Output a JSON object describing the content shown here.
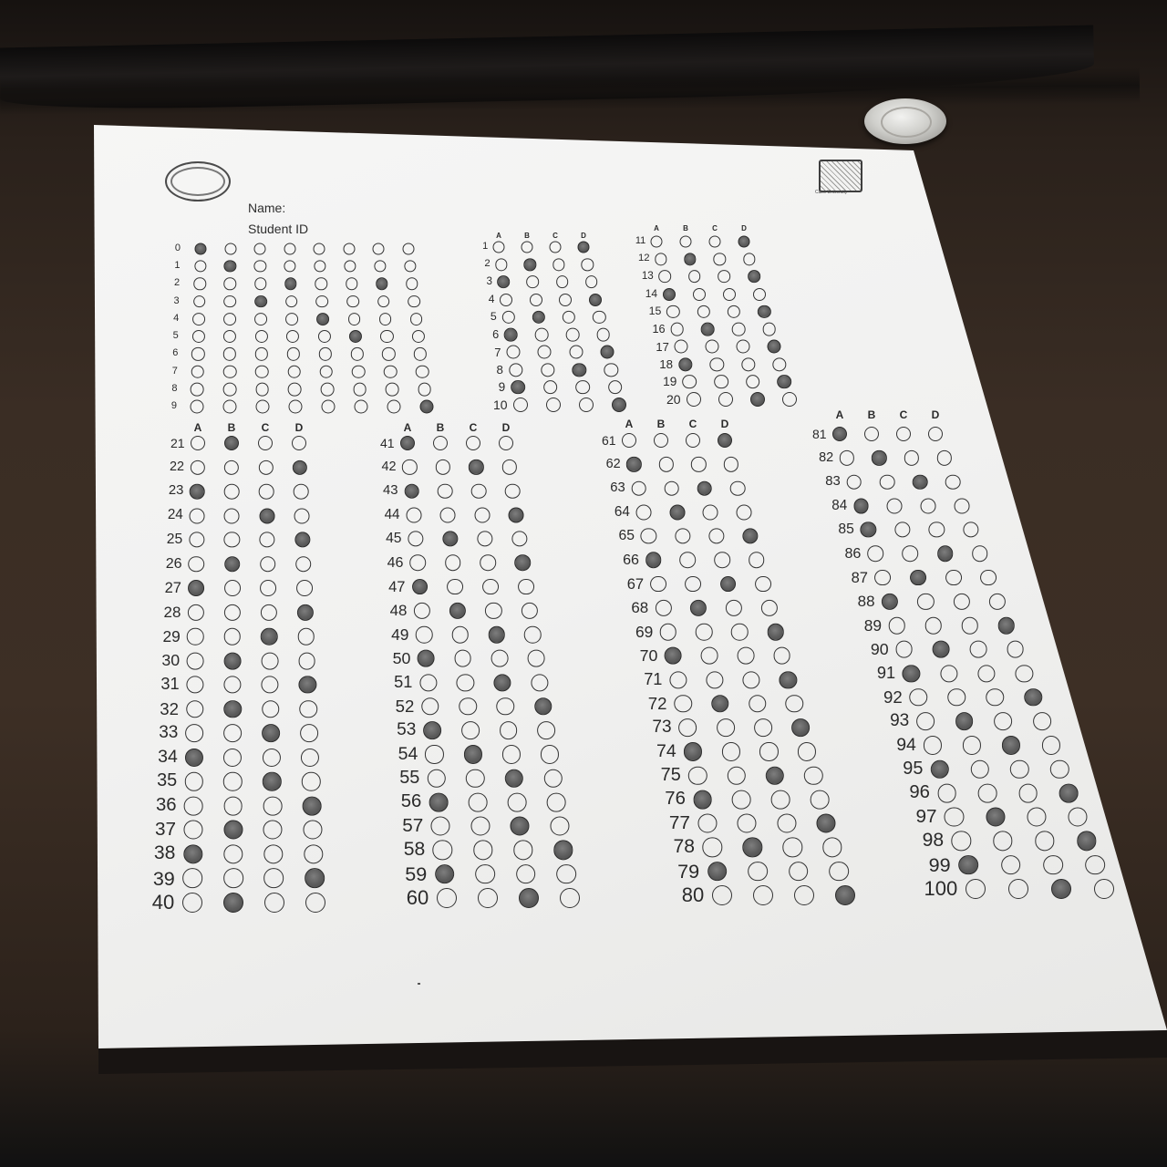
{
  "form": {
    "name_label": "Name:",
    "student_id_label": "Student ID",
    "right_logo_caption": "Cairo University"
  },
  "student_id": {
    "digit_labels": [
      "0",
      "1",
      "2",
      "3",
      "4",
      "5",
      "6",
      "7",
      "8",
      "9"
    ],
    "marked_digit_per_column": [
      0,
      1,
      3,
      2,
      4,
      5,
      2,
      9
    ]
  },
  "answer_letters": [
    "A",
    "B",
    "C",
    "D"
  ],
  "answers": {
    "1": "D",
    "2": "B",
    "3": "A",
    "4": "D",
    "5": "B",
    "6": "A",
    "7": "D",
    "8": "C",
    "9": "A",
    "10": "D",
    "11": "D",
    "12": "B",
    "13": "D",
    "14": "A",
    "15": "D",
    "16": "B",
    "17": "D",
    "18": "A",
    "19": "D",
    "20": "C",
    "21": "B",
    "22": "D",
    "23": "A",
    "24": "C",
    "25": "D",
    "26": "B",
    "27": "A",
    "28": "D",
    "29": "C",
    "30": "B",
    "31": "D",
    "32": "B",
    "33": "C",
    "34": "A",
    "35": "C",
    "36": "D",
    "37": "B",
    "38": "A",
    "39": "D",
    "40": "B",
    "41": "A",
    "42": "C",
    "43": "A",
    "44": "D",
    "45": "B",
    "46": "D",
    "47": "A",
    "48": "B",
    "49": "C",
    "50": "A",
    "51": "C",
    "52": "D",
    "53": "A",
    "54": "B",
    "55": "C",
    "56": "A",
    "57": "C",
    "58": "D",
    "59": "A",
    "60": "C",
    "61": "D",
    "62": "A",
    "63": "C",
    "64": "B",
    "65": "D",
    "66": "A",
    "67": "C",
    "68": "B",
    "69": "D",
    "70": "A",
    "71": "D",
    "72": "B",
    "73": "D",
    "74": "A",
    "75": "C",
    "76": "A",
    "77": "D",
    "78": "B",
    "79": "A",
    "80": "D",
    "81": "A",
    "82": "B",
    "83": "C",
    "84": "A",
    "85": "A",
    "86": "C",
    "87": "B",
    "88": "A",
    "89": "D",
    "90": "B",
    "91": "A",
    "92": "D",
    "93": "B",
    "94": "C",
    "95": "A",
    "96": "D",
    "97": "B",
    "98": "D",
    "99": "A",
    "100": "C"
  },
  "colors": {
    "paper": "#f2f2f1",
    "ink": "#2a2a2a",
    "pencil_fill": "#5c5c5c",
    "table": "#3a2d24"
  }
}
